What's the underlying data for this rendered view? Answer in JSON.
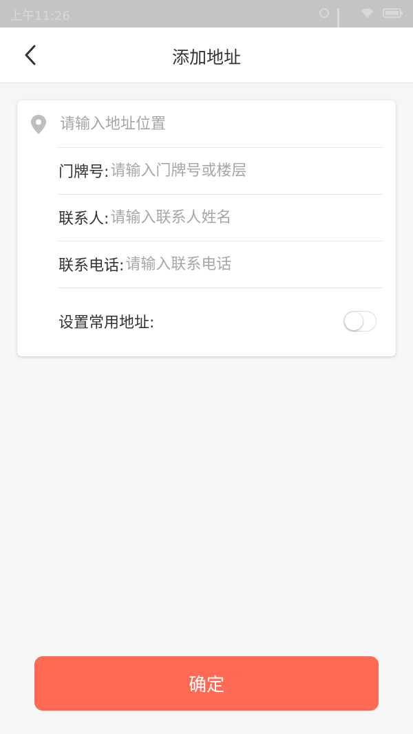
{
  "status_bar": {
    "time": "上午11:26"
  },
  "header": {
    "title": "添加地址"
  },
  "form": {
    "address_placeholder": "请输入地址位置",
    "door_label": "门牌号:",
    "door_placeholder": "请输入门牌号或楼层",
    "contact_label": "联系人:",
    "contact_placeholder": "请输入联系人姓名",
    "phone_label": "联系电话:",
    "phone_placeholder": "请输入联系电话",
    "default_label": "设置常用地址:",
    "default_enabled": false
  },
  "actions": {
    "confirm_label": "确定"
  },
  "colors": {
    "accent": "#ff6a55",
    "background": "#f6f6f6",
    "placeholder": "#a6a6a6"
  },
  "icons": {
    "back": "chevron-left-icon",
    "location": "location-pin-icon"
  }
}
